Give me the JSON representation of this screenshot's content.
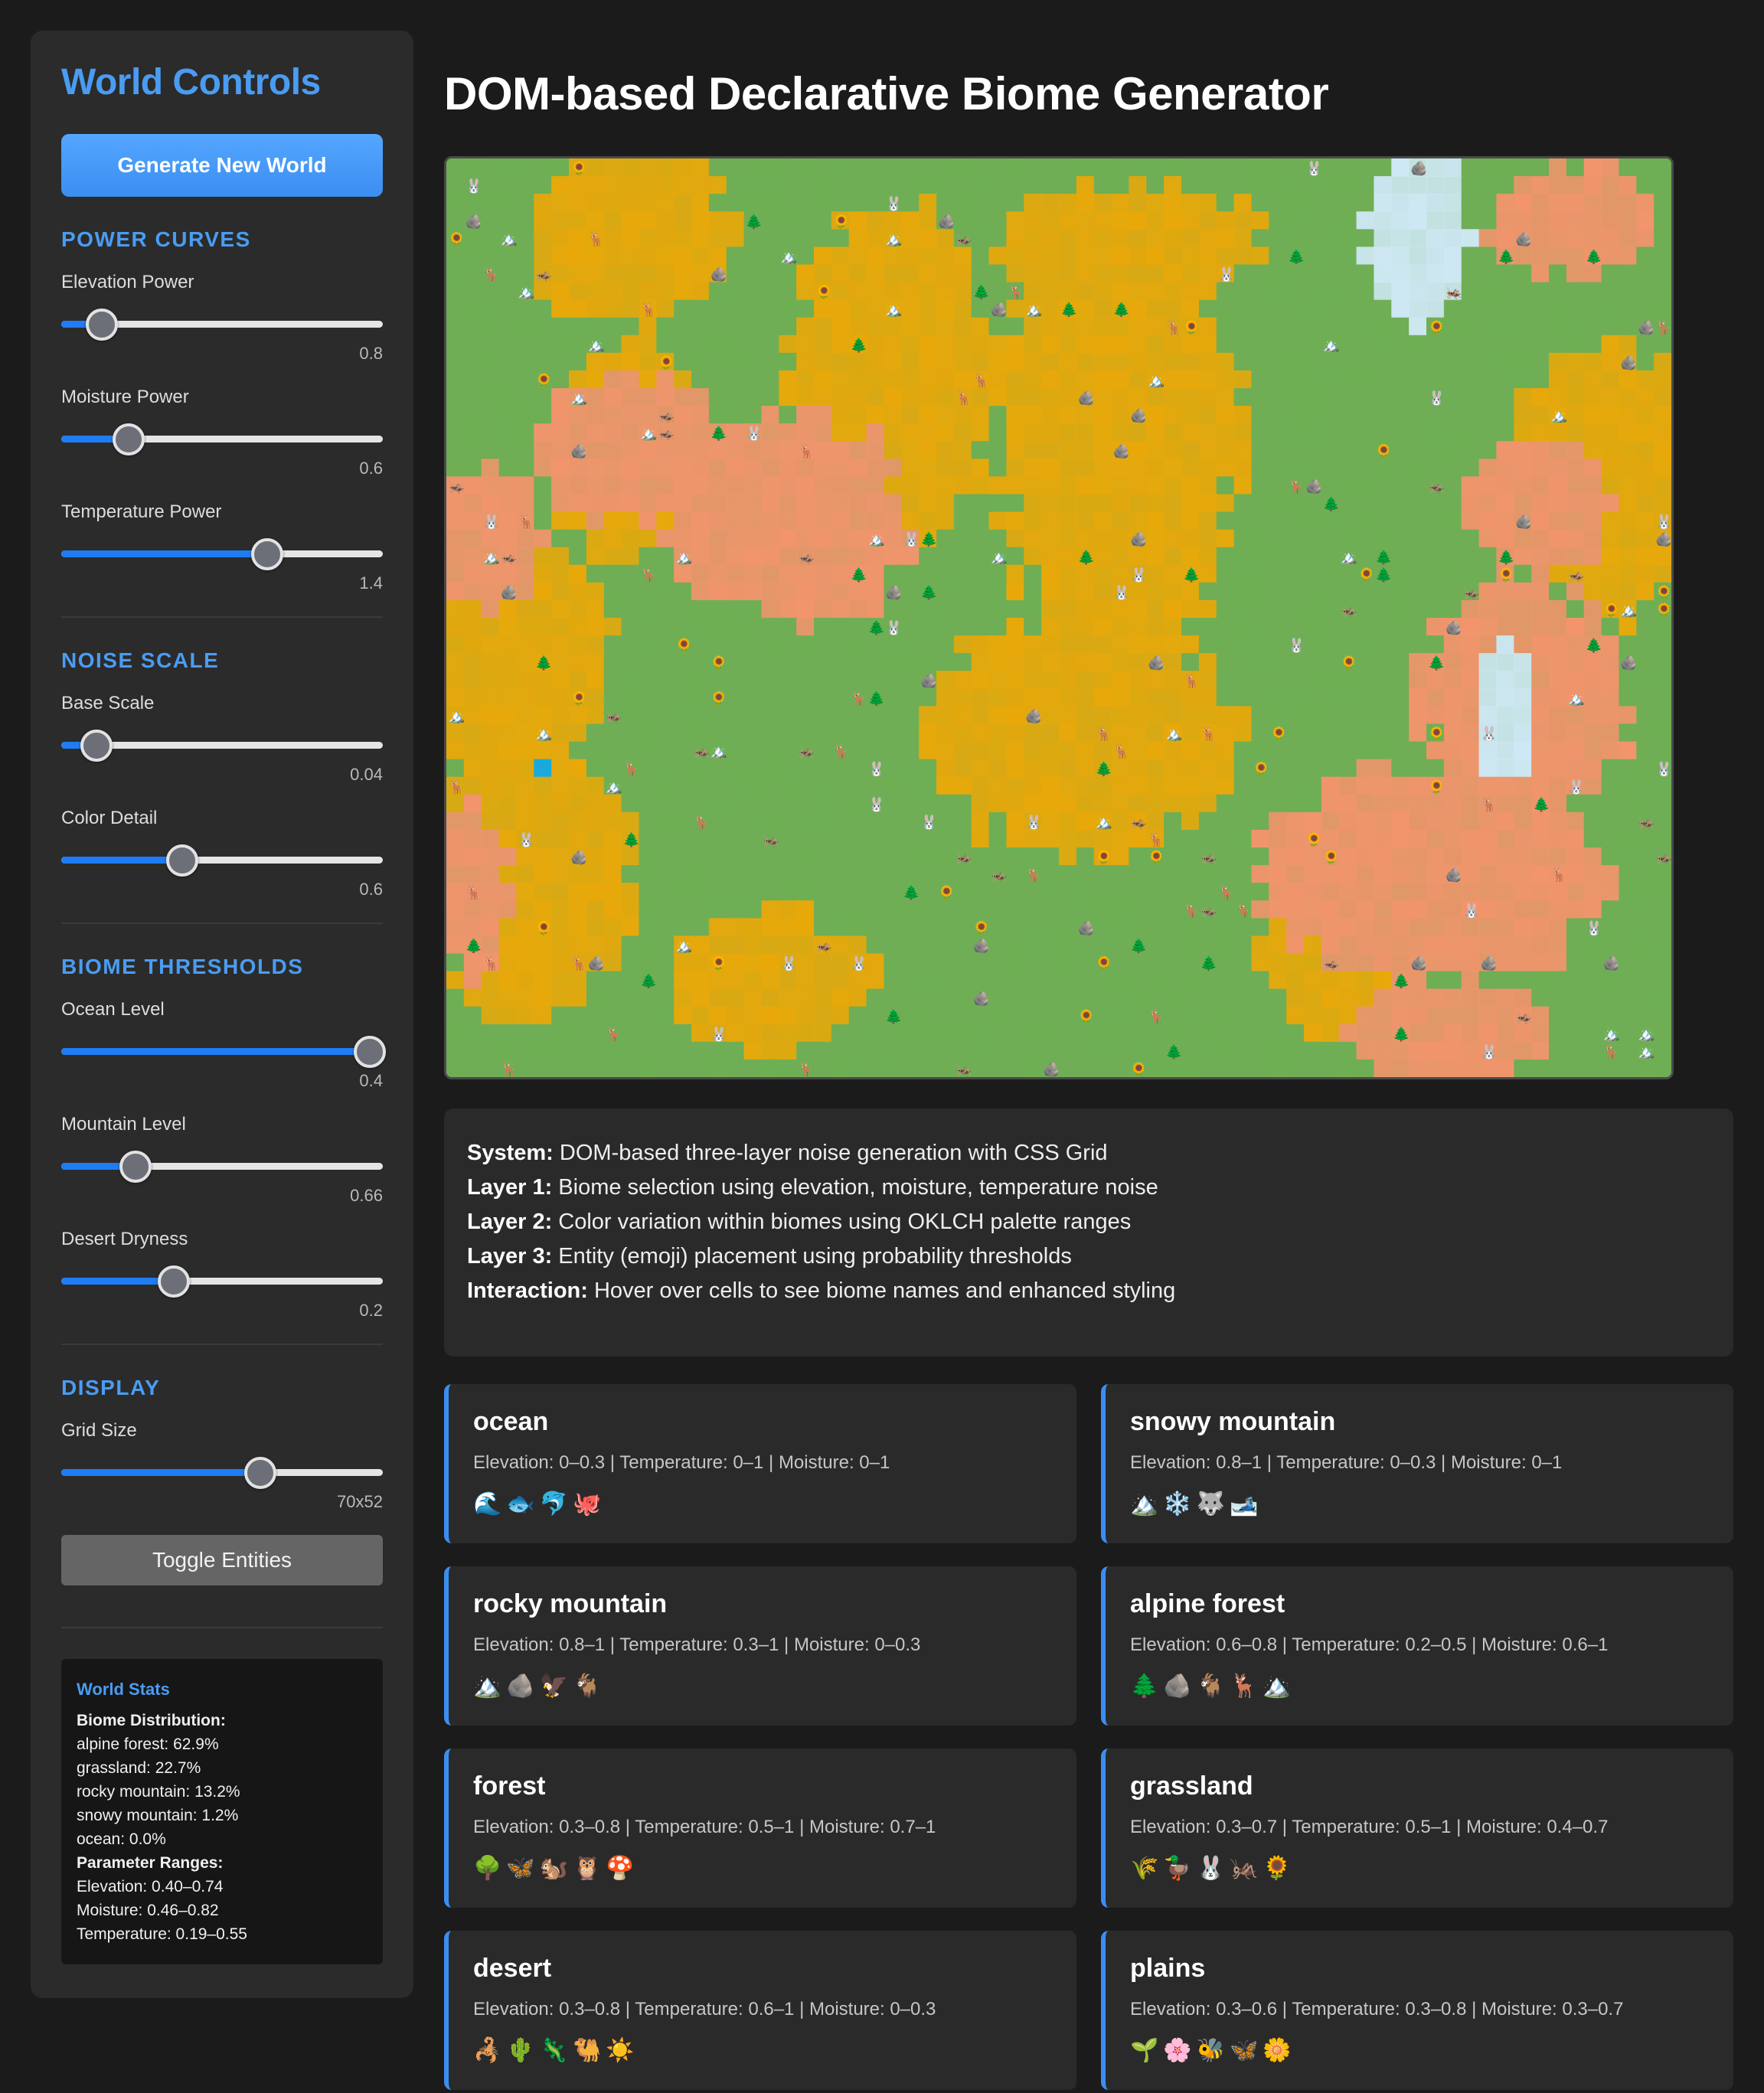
{
  "sidebar": {
    "title": "World Controls",
    "generate_label": "Generate New World",
    "sections": {
      "power": "POWER CURVES",
      "noise": "NOISE SCALE",
      "thresholds": "BIOME THRESHOLDS",
      "display": "DISPLAY"
    },
    "sliders": {
      "elevation_power": {
        "label": "Elevation Power",
        "value": "0.8",
        "level": 0.125
      },
      "moisture_power": {
        "label": "Moisture Power",
        "value": "0.6",
        "level": 0.21
      },
      "temperature_power": {
        "label": "Temperature Power",
        "value": "1.4",
        "level": 0.64
      },
      "base_scale": {
        "label": "Base Scale",
        "value": "0.04",
        "level": 0.11
      },
      "color_detail": {
        "label": "Color Detail",
        "value": "0.6",
        "level": 0.375
      },
      "ocean_level": {
        "label": "Ocean Level",
        "value": "0.4",
        "level": 0.96
      },
      "mountain_level": {
        "label": "Mountain Level",
        "value": "0.66",
        "level": 0.23
      },
      "desert_dryness": {
        "label": "Desert Dryness",
        "value": "0.2",
        "level": 0.35
      },
      "grid_size": {
        "label": "Grid Size",
        "value": "70x52",
        "level": 0.62
      }
    },
    "toggle_label": "Toggle Entities",
    "stats": {
      "title": "World Stats",
      "dist_heading": "Biome Distribution:",
      "distribution": [
        "alpine forest: 62.9%",
        "grassland: 22.7%",
        "rocky mountain: 13.2%",
        "snowy mountain: 1.2%",
        "ocean: 0.0%"
      ],
      "range_heading": "Parameter Ranges:",
      "ranges": [
        "Elevation: 0.40–0.74",
        "Moisture: 0.46–0.82",
        "Temperature: 0.19–0.55"
      ]
    }
  },
  "main": {
    "title": "DOM-based Declarative Biome Generator",
    "info": [
      {
        "key": "System:",
        "text": " DOM-based three-layer noise generation with CSS Grid"
      },
      {
        "key": "Layer 1:",
        "text": " Biome selection using elevation, moisture, temperature noise"
      },
      {
        "key": "Layer 2:",
        "text": " Color variation within biomes using OKLCH palette ranges"
      },
      {
        "key": "Layer 3:",
        "text": " Entity (emoji) placement using probability thresholds"
      },
      {
        "key": "Interaction:",
        "text": " Hover over cells to see biome names and enhanced styling"
      }
    ],
    "biomes": [
      {
        "name": "ocean",
        "ranges": "Elevation: 0–0.3 | Temperature: 0–1 | Moisture: 0–1",
        "emojis": "🌊🐟🐬🐙"
      },
      {
        "name": "snowy mountain",
        "ranges": "Elevation: 0.8–1 | Temperature: 0–0.3 | Moisture: 0–1",
        "emojis": "🏔️❄️🐺🎿"
      },
      {
        "name": "rocky mountain",
        "ranges": "Elevation: 0.8–1 | Temperature: 0.3–1 | Moisture: 0–0.3",
        "emojis": "🏔️🪨🦅🐐"
      },
      {
        "name": "alpine forest",
        "ranges": "Elevation: 0.6–0.8 | Temperature: 0.2–0.5 | Moisture: 0.6–1",
        "emojis": "🌲🪨🐐🦌🏔️"
      },
      {
        "name": "forest",
        "ranges": "Elevation: 0.3–0.8 | Temperature: 0.5–1 | Moisture: 0.7–1",
        "emojis": "🌳🦋🐿️🦉🍄"
      },
      {
        "name": "grassland",
        "ranges": "Elevation: 0.3–0.7 | Temperature: 0.5–1 | Moisture: 0.4–0.7",
        "emojis": "🌾🦆🐰🦗🌻"
      },
      {
        "name": "desert",
        "ranges": "Elevation: 0.3–0.8 | Temperature: 0.6–1 | Moisture: 0–0.3",
        "emojis": "🦂🌵🦎🐫☀️"
      },
      {
        "name": "plains",
        "ranges": "Elevation: 0.3–0.6 | Temperature: 0.3–0.8 | Moisture: 0.3–0.7",
        "emojis": "🌱🌸🐝🦋🌼"
      }
    ],
    "map": {
      "cols": 70,
      "rows": 52,
      "colors": {
        "alpine_forest": "#6fae55",
        "grassland": "#e8a80a",
        "rocky_mountain": "#f2946c",
        "snowy_mountain": "#cfe8f5",
        "ocean": "#19a8e0"
      },
      "entities": [
        "🌲",
        "🦌",
        "🏔️",
        "🪨",
        "🐰",
        "🦗",
        "🌻"
      ]
    }
  }
}
